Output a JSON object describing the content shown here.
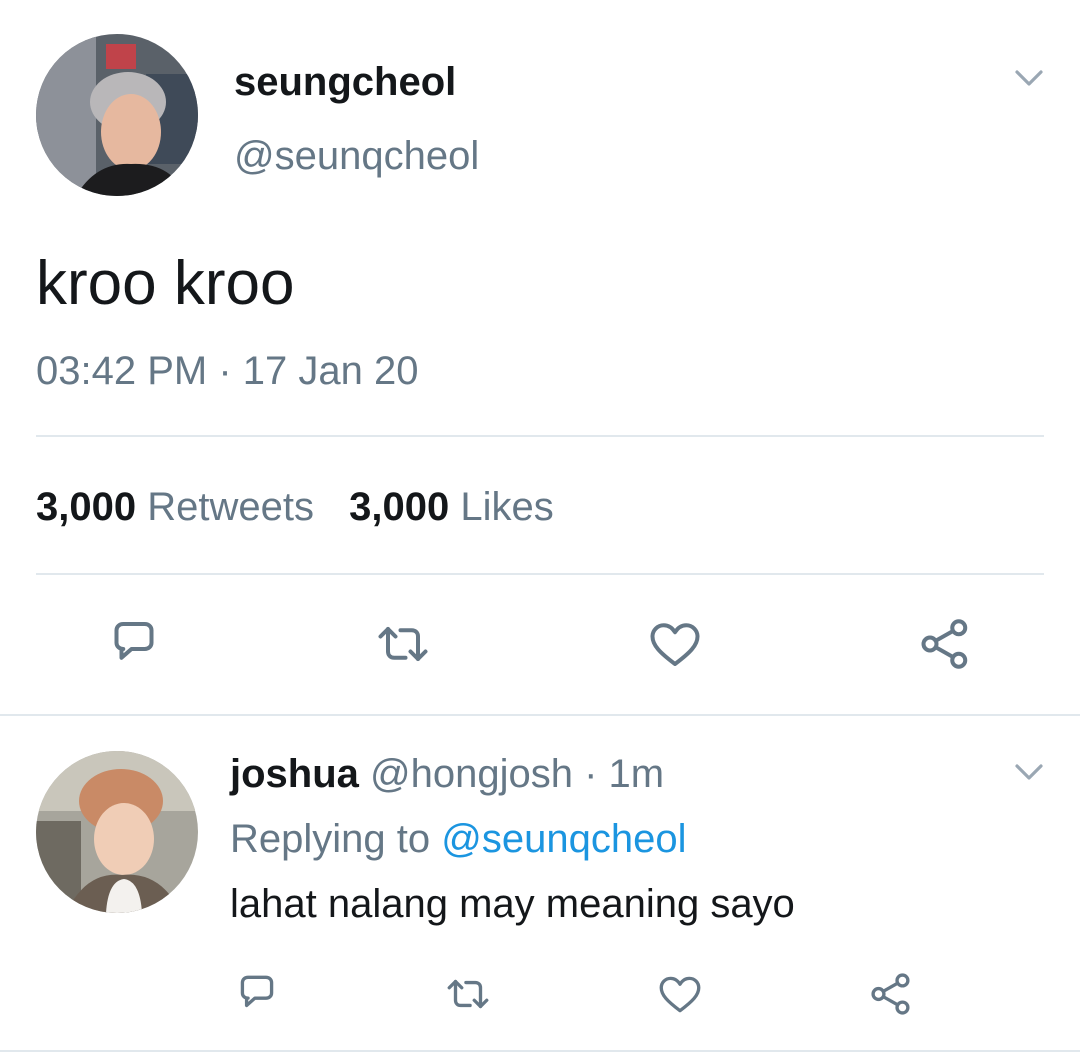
{
  "main_tweet": {
    "display_name": "seungcheol",
    "handle": "@seunqcheol",
    "text": "kroo kroo",
    "timestamp": "03:42 PM · 17 Jan 20",
    "retweets_count": "3,000",
    "retweets_label": "Retweets",
    "likes_count": "3,000",
    "likes_label": "Likes"
  },
  "reply": {
    "display_name": "joshua",
    "handle": "@hongjosh",
    "time": "· 1m",
    "replying_prefix": "Replying to",
    "replying_handle": "@seunqcheol",
    "text": "lahat nalang may meaning sayo"
  },
  "icons": {
    "menu": "chevron-down-icon",
    "reply": "reply-icon",
    "retweet": "retweet-icon",
    "like": "heart-icon",
    "share": "share-icon"
  },
  "colors": {
    "primary_text": "#14171a",
    "secondary_text": "#657786",
    "link": "#1b95e0",
    "divider": "#e1e8ed"
  }
}
